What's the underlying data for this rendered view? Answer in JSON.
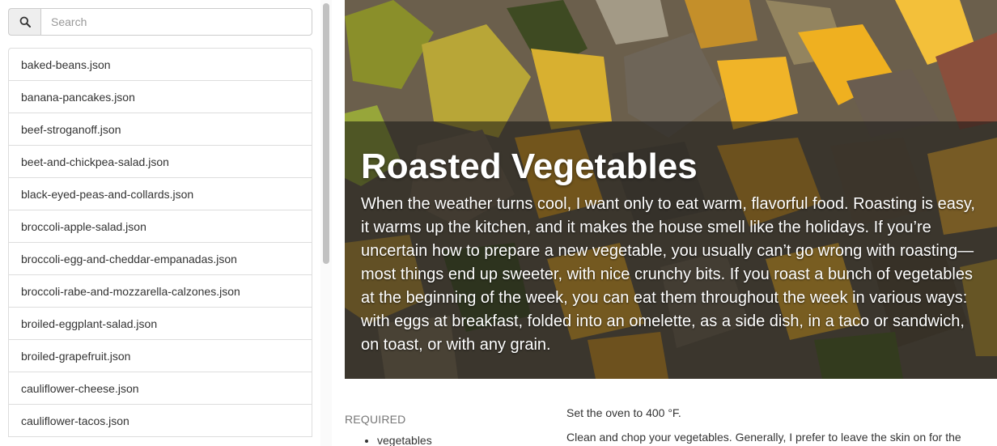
{
  "search": {
    "placeholder": "Search",
    "icon": "search-icon"
  },
  "files": [
    "baked-beans.json",
    "banana-pancakes.json",
    "beef-stroganoff.json",
    "beet-and-chickpea-salad.json",
    "black-eyed-peas-and-collards.json",
    "broccoli-apple-salad.json",
    "broccoli-egg-and-cheddar-empanadas.json",
    "broccoli-rabe-and-mozzarella-calzones.json",
    "broiled-eggplant-salad.json",
    "broiled-grapefruit.json",
    "cauliflower-cheese.json",
    "cauliflower-tacos.json"
  ],
  "recipe": {
    "title": "Roasted Vegetables",
    "description": "When the weather turns cool, I want only to eat warm, flavorful food. Roasting is easy, it warms up the kitchen, and it makes the house smell like the holidays. If you’re uncertain how to prepare a new vegetable, you usually can’t go wrong with roasting— most things end up sweeter, with nice crunchy bits. If you roast a bunch of vegetables at the beginning of the week, you can eat them throughout the week in various ways: with eggs at breakfast, folded into an omelette, as a side dish, in a taco or sandwich, on toast, or with any grain.",
    "required_label": "REQUIRED",
    "ingredients": [
      "vegetables"
    ],
    "directions": [
      "Set the oven to 400 °F.",
      "Clean and chop your vegetables. Generally, I prefer to leave the skin on for the"
    ]
  }
}
